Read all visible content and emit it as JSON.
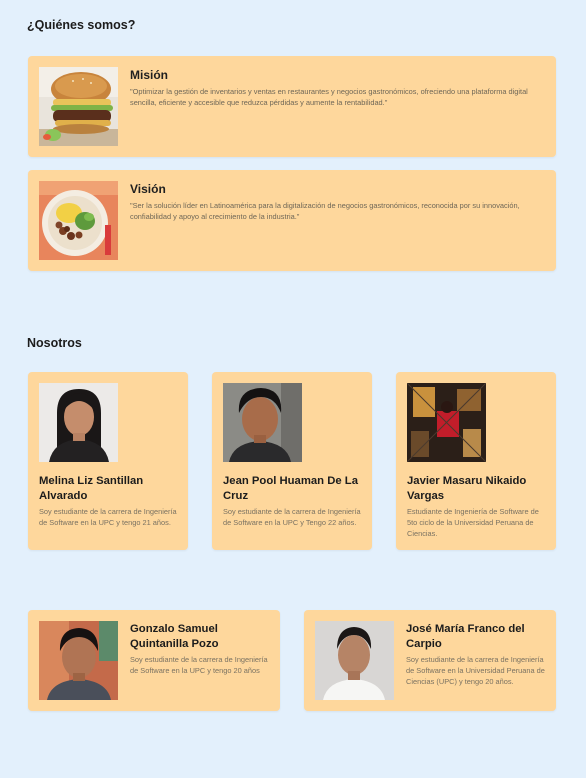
{
  "about": {
    "title": "¿Quiénes somos?",
    "mission": {
      "title": "Misión",
      "text": "\"Optimizar la gestión de inventarios y ventas en restaurantes y negocios gastronómicos, ofreciendo una plataforma digital sencilla, eficiente y accesible que reduzca pérdidas y aumente la rentabilidad.\""
    },
    "vision": {
      "title": "Visión",
      "text": "\"Ser la solución líder en Latinoamérica para la digitalización de negocios gastronómicos, reconocida por su innovación, confiabilidad y apoyo al crecimiento de la industria.\""
    }
  },
  "team": {
    "title": "Nosotros",
    "members": [
      {
        "name": "Melina Liz Santillan Alvarado",
        "desc": "Soy estudiante de la carrera de Ingeniería de Software en la UPC y tengo 21 años."
      },
      {
        "name": "Jean Pool Huaman De La Cruz",
        "desc": "Soy estudiante de la carrera de Ingeniería de Software en la UPC y Tengo 22 años."
      },
      {
        "name": "Javier Masaru Nikaido Vargas",
        "desc": "Estudiante de Ingeniería de Software de 5to ciclo de la Universidad Peruana de Ciencias."
      },
      {
        "name": "Gonzalo Samuel Quintanilla Pozo",
        "desc": "Soy estudiante de la carrera de Ingeniería de Software en la UPC y tengo 20 años"
      },
      {
        "name": "José María Franco del Carpio",
        "desc": "Soy estudiante de la carrera de Ingeniería de Software en la Universidad Peruana de Ciencias (UPC) y tengo 20 años."
      }
    ]
  },
  "colors": {
    "page_background": "#e3f0fc",
    "card_background": "#fed79c"
  }
}
